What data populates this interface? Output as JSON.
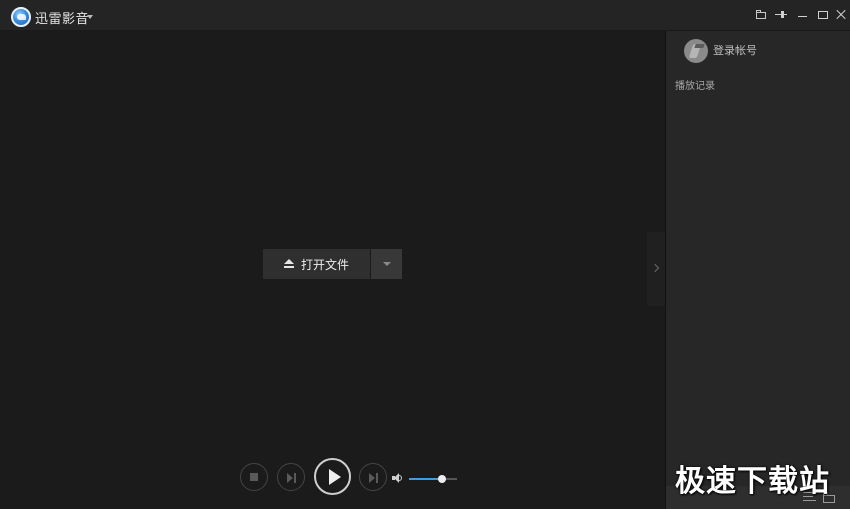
{
  "titlebar": {
    "app_name": "迅雷影音",
    "icons": {
      "app_logo": "xunlei-logo-icon",
      "open_folder": "folder-icon",
      "pin": "pin-icon",
      "minimize": "minimize-icon",
      "maximize": "maximize-icon",
      "close": "close-icon"
    }
  },
  "main": {
    "open_file_label": "打开文件",
    "open_file_icon": "eject-icon",
    "dropdown_icon": "chevron-down-icon"
  },
  "controls": {
    "icons": [
      "stop-icon",
      "previous-icon",
      "play-icon",
      "next-icon",
      "volume-icon"
    ],
    "volume_level": 0.68,
    "accent_color": "#3a9ee8"
  },
  "side_panel": {
    "login_label": "登录帐号",
    "history_title": "播放记录",
    "bottom_icons": [
      "playlist-icon",
      "folder-icon"
    ]
  },
  "watermark": {
    "text": "极速下载站"
  }
}
